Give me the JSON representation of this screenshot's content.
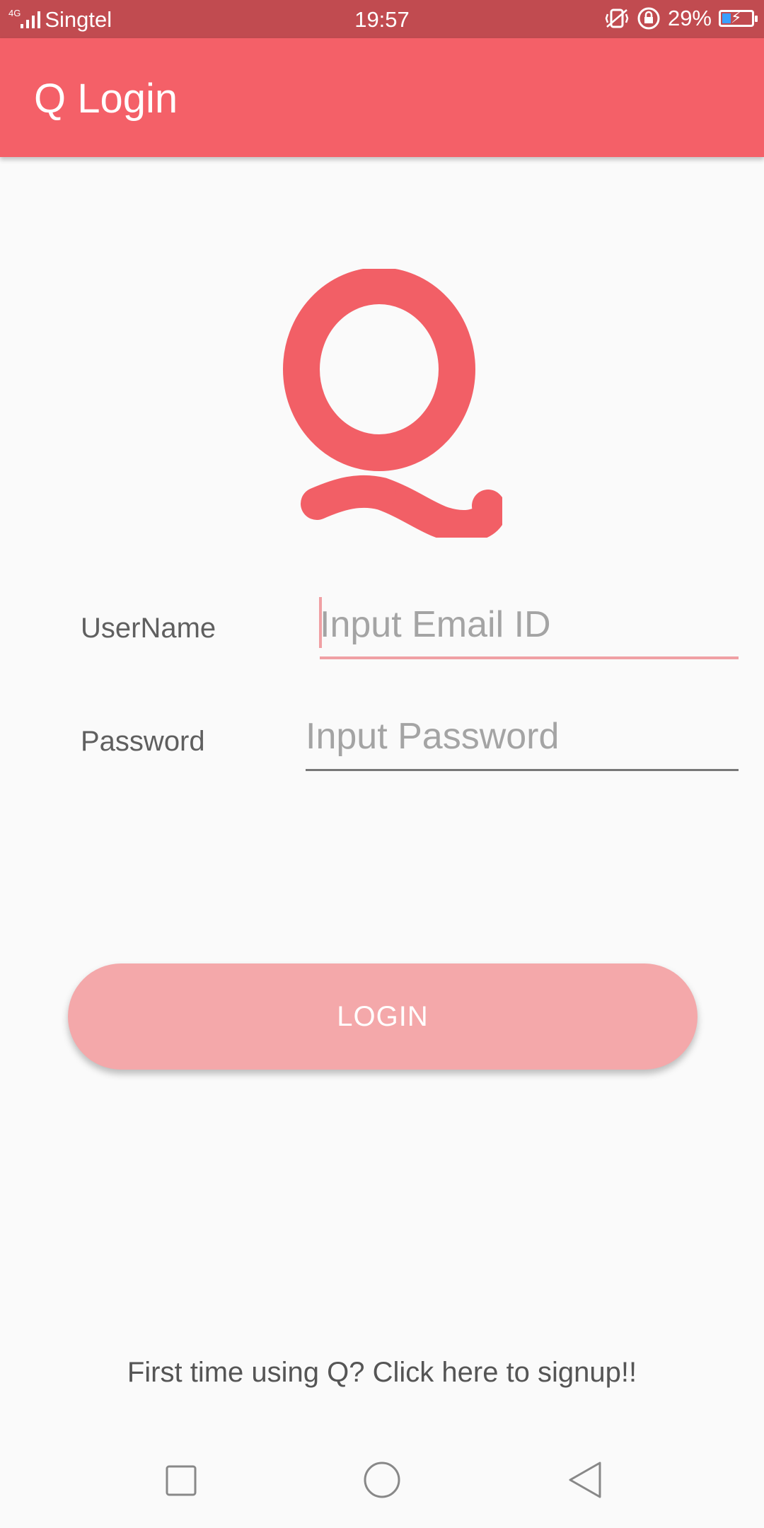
{
  "status": {
    "network": "4G",
    "carrier": "Singtel",
    "time": "19:57",
    "battery_percent": "29%",
    "battery_level": 0.29
  },
  "app_bar": {
    "title": "Q Login"
  },
  "logo": {
    "letter": "Q",
    "color": "#f25f66"
  },
  "form": {
    "username_label": "UserName",
    "username_placeholder": "Input Email ID",
    "password_label": "Password",
    "password_placeholder": "Input Password"
  },
  "login_button": {
    "label": "LOGIN"
  },
  "signup": {
    "text": "First time using Q? Click here to signup!!"
  },
  "colors": {
    "primary": "#f46068",
    "status_bar": "#c14b50",
    "button": "#f4a8aa"
  },
  "icons": [
    "signal-icon",
    "vibrate-icon",
    "rotation-lock-icon",
    "battery-icon",
    "recents-icon",
    "home-icon",
    "back-icon"
  ]
}
